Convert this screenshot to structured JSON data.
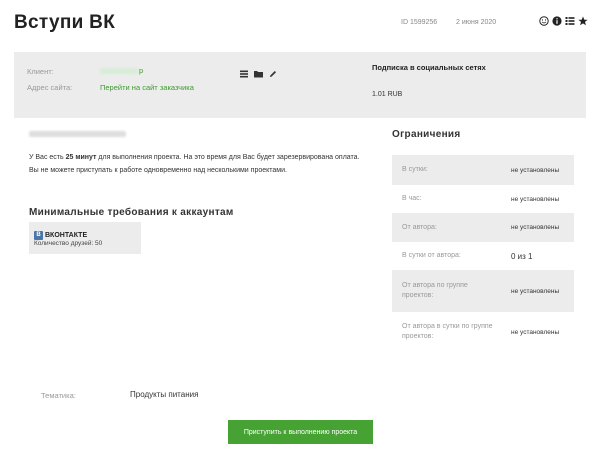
{
  "header": {
    "title": "Вступи ВК",
    "id_text": "ID 1599256",
    "date": "2 июня 2020",
    "icons": [
      "smiley-icon",
      "info-icon",
      "list-icon",
      "star-icon"
    ]
  },
  "info": {
    "client_label": "Клиент:",
    "client_suffix": "р",
    "site_label": "Адрес сайта:",
    "site_link": "Перейти на сайт заказчика",
    "tool_icons": [
      "list-icon",
      "folder-icon",
      "pencil-icon"
    ],
    "subs_title": "Подписка в социальных сетях",
    "price": "1.01 RUB"
  },
  "body": {
    "reserve_pre": "У Вас есть ",
    "reserve_bold": "25 минут",
    "reserve_post": " для выполнения проекта. На это время для Вас будет зарезервирована оплата.",
    "parallel_text": "Вы не можете приступать к работе одновременно над несколькими проектами."
  },
  "requirements": {
    "title": "Минимальные требования к аккаунтам",
    "network_badge": "В",
    "network": "ВКОНТАКТЕ",
    "friends": "Количество друзей: 50"
  },
  "limits": {
    "title": "Ограничения",
    "rows": [
      {
        "label": "В сутки:",
        "value": "не установлены"
      },
      {
        "label": "В час:",
        "value": "не установлены"
      },
      {
        "label": "От автора:",
        "value": "не установлены"
      },
      {
        "label": "В сутки от автора:",
        "value": "0 из 1"
      },
      {
        "label": "От автора по группе проектов:",
        "value": "не установлены"
      },
      {
        "label": "От автора в сутки по группе проектов:",
        "value": "не установлены"
      }
    ]
  },
  "theme": {
    "label": "Тематика:",
    "value": "Продукты питания"
  },
  "action": {
    "button": "Приступить к выполнению проекта"
  },
  "colors": {
    "accent": "#46a333",
    "link": "#3c9a2e",
    "panel": "#ececec"
  }
}
